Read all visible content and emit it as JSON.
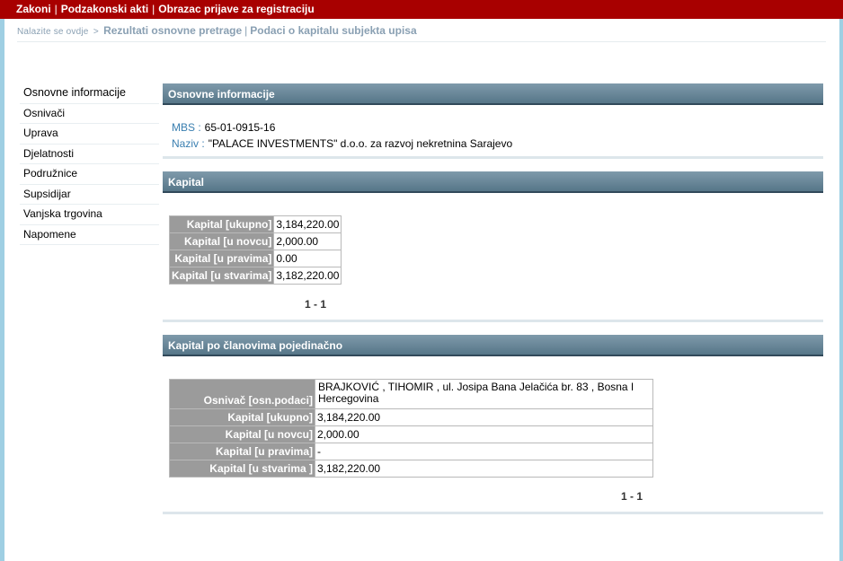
{
  "topnav": {
    "link1": "Zakoni",
    "link2": "Podzakonski akti",
    "link3": "Obrazac prijave za registraciju",
    "separator": "|"
  },
  "breadcrumb": {
    "prefix": "Nalazite se ovdje",
    "arrow": ">",
    "link1": "Rezultati osnovne pretrage",
    "separator": "|",
    "current": "Podaci o kapitalu subjekta upisa"
  },
  "sidebar": {
    "items": [
      {
        "label": "Osnovne informacije"
      },
      {
        "label": "Osnivači"
      },
      {
        "label": "Uprava"
      },
      {
        "label": "Djelatnosti"
      },
      {
        "label": "Podružnice"
      },
      {
        "label": "Supsidijar"
      },
      {
        "label": "Vanjska trgovina"
      },
      {
        "label": "Napomene"
      }
    ]
  },
  "osnovne": {
    "title": "Osnovne informacije",
    "mbs_label": "MBS :",
    "mbs_value": "65-01-0915-16",
    "naziv_label": "Naziv :",
    "naziv_value": "\"PALACE INVESTMENTS\" d.o.o. za razvoj nekretnina Sarajevo"
  },
  "kapital": {
    "title": "Kapital",
    "rows": [
      {
        "label": "Kapital [ukupno]",
        "value": "3,184,220.00"
      },
      {
        "label": "Kapital [u novcu]",
        "value": "2,000.00"
      },
      {
        "label": "Kapital [u pravima]",
        "value": "0.00"
      },
      {
        "label": "Kapital [u stvarima]",
        "value": "3,182,220.00"
      }
    ],
    "pager": "1 - 1"
  },
  "clanovi": {
    "title": "Kapital po članovima pojedinačno",
    "rows": [
      {
        "label": "Osnivač [osn.podaci]",
        "value": "BRAJKOVIĆ , TIHOMIR , ul. Josipa Bana Jelačića br. 83 , Bosna I Hercegovina"
      },
      {
        "label": "Kapital [ukupno]",
        "value": "3,184,220.00"
      },
      {
        "label": "Kapital [u novcu]",
        "value": "2,000.00"
      },
      {
        "label": "Kapital [u pravima]",
        "value": "-"
      },
      {
        "label": "Kapital [u stvarima ]",
        "value": "3,182,220.00"
      }
    ],
    "pager": "1 - 1"
  },
  "colors": {
    "topbar": "#a80000",
    "section_header": "#567688",
    "label_cell": "#9b9b9b",
    "link_blue": "#3a7fb0",
    "page_background": "#9fcfe3"
  }
}
